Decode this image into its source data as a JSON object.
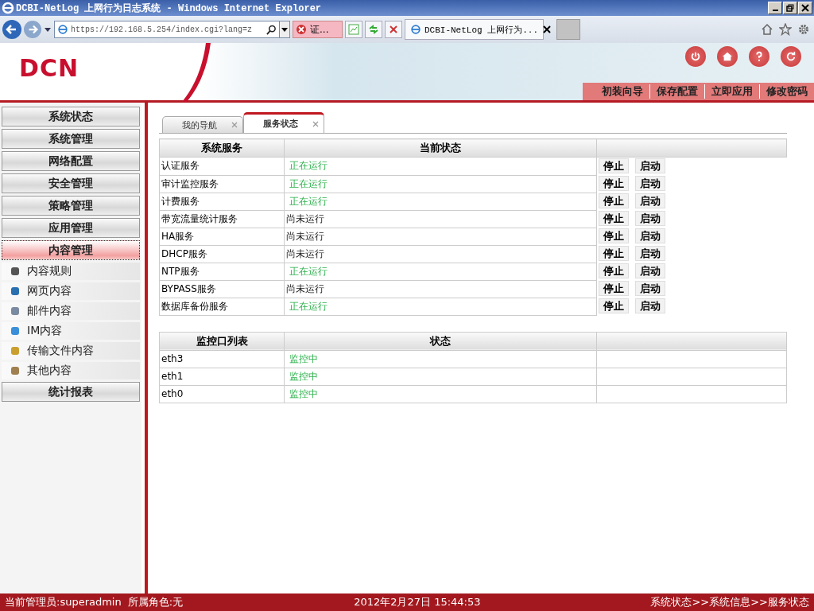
{
  "window": {
    "title": "DCBI-NetLog 上网行为日志系统 - Windows Internet Explorer"
  },
  "browser": {
    "address": "https://192.168.5.254/index.cgi?lang=z",
    "cert_label": "证...",
    "tab_title": "DCBI-NetLog 上网行为..."
  },
  "header": {
    "logo": "DCN",
    "links": [
      "初装向导",
      "保存配置",
      "立即应用",
      "修改密码"
    ]
  },
  "sidebar": {
    "items": [
      {
        "label": "系统状态",
        "selected": false
      },
      {
        "label": "系统管理",
        "selected": false
      },
      {
        "label": "网络配置",
        "selected": false
      },
      {
        "label": "安全管理",
        "selected": false
      },
      {
        "label": "策略管理",
        "selected": false
      },
      {
        "label": "应用管理",
        "selected": false
      },
      {
        "label": "内容管理",
        "selected": true,
        "children": [
          {
            "label": "内容规则",
            "kind": "rule"
          },
          {
            "label": "网页内容",
            "kind": "web"
          },
          {
            "label": "邮件内容",
            "kind": "mail"
          },
          {
            "label": "IM内容",
            "kind": "im"
          },
          {
            "label": "传输文件内容",
            "kind": "file"
          },
          {
            "label": "其他内容",
            "kind": "other"
          }
        ]
      },
      {
        "label": "统计报表",
        "selected": false
      }
    ]
  },
  "tabs": [
    {
      "label": "我的导航",
      "selected": false
    },
    {
      "label": "服务状态",
      "selected": true
    }
  ],
  "services_table": {
    "columns": [
      "系统服务",
      "当前状态"
    ],
    "rows": [
      {
        "name": "认证服务",
        "status": "正在运行",
        "running": true,
        "actions": [
          "停止",
          "启动"
        ]
      },
      {
        "name": "审计监控服务",
        "status": "正在运行",
        "running": true,
        "actions": [
          "停止",
          "启动"
        ]
      },
      {
        "name": "计费服务",
        "status": "正在运行",
        "running": true,
        "actions": [
          "停止",
          "启动"
        ]
      },
      {
        "name": "带宽流量统计服务",
        "status": "尚未运行",
        "running": false,
        "actions": [
          "停止",
          "启动"
        ]
      },
      {
        "name": "HA服务",
        "status": "尚未运行",
        "running": false,
        "actions": [
          "停止",
          "启动"
        ]
      },
      {
        "name": "DHCP服务",
        "status": "尚未运行",
        "running": false,
        "actions": [
          "停止",
          "启动"
        ]
      },
      {
        "name": "NTP服务",
        "status": "正在运行",
        "running": true,
        "actions": [
          "停止",
          "启动"
        ]
      },
      {
        "name": "BYPASS服务",
        "status": "尚未运行",
        "running": false,
        "actions": [
          "停止",
          "启动"
        ]
      },
      {
        "name": "数据库备份服务",
        "status": "正在运行",
        "running": true,
        "actions": [
          "停止",
          "启动"
        ]
      }
    ]
  },
  "monitor_table": {
    "columns": [
      "监控口列表",
      "状态"
    ],
    "rows": [
      {
        "name": "eth3",
        "status": "监控中",
        "running": true
      },
      {
        "name": "eth1",
        "status": "监控中",
        "running": true
      },
      {
        "name": "eth0",
        "status": "监控中",
        "running": true
      }
    ]
  },
  "status_bar": {
    "user": "当前管理员:superadmin",
    "role": "所属角色:无",
    "datetime": "2012年2月27日 15:44:53",
    "breadcrumb": "系统状态>>系统信息>>服务状态"
  }
}
